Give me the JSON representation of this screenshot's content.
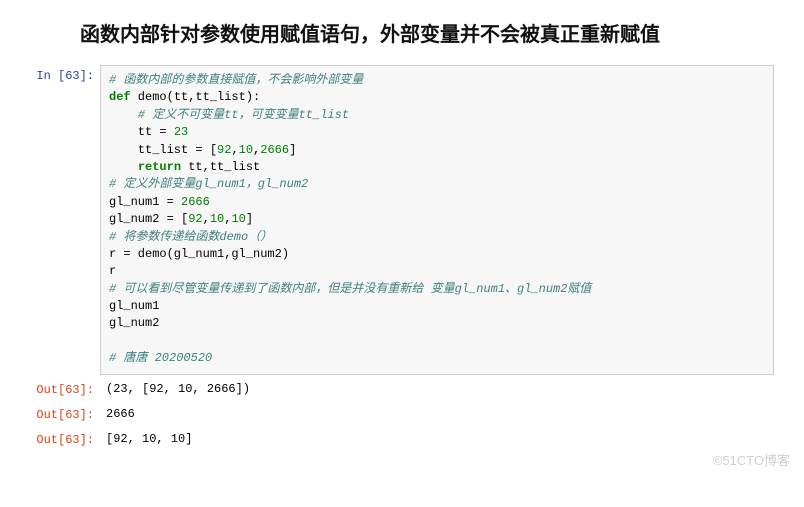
{
  "title": "函数内部针对参数使用赋值语句，外部变量并不会被真正重新赋值",
  "prompts": {
    "in": "In  [63]:",
    "out": "Out[63]:"
  },
  "code": {
    "l01": "# 函数内部的参数直接赋值，不会影响外部变量",
    "l02a": "def",
    "l02b": " demo(tt,tt_list):",
    "l03": "    # 定义不可变量tt，可变变量tt_list",
    "l04a": "    tt = ",
    "l04b": "23",
    "l05a": "    tt_list = [",
    "l05b": "92",
    "l05c": ",",
    "l05d": "10",
    "l05e": ",",
    "l05f": "2666",
    "l05g": "]",
    "l06a": "    ",
    "l06b": "return",
    "l06c": " tt,tt_list",
    "l07": "# 定义外部变量gl_num1，gl_num2",
    "l08a": "gl_num1 = ",
    "l08b": "2666",
    "l09a": "gl_num2 = [",
    "l09b": "92",
    "l09c": ",",
    "l09d": "10",
    "l09e": ",",
    "l09f": "10",
    "l09g": "]",
    "l10": "# 将参数传递给函数demo（）",
    "l11": "r = demo(gl_num1,gl_num2)",
    "l12": "r",
    "l13": "# 可以看到尽管变量传递到了函数内部，但是并没有重新给 变量gl_num1、gl_num2赋值",
    "l14": "gl_num1",
    "l15": "gl_num2",
    "l16": "",
    "l17": "# 唐唐 20200520"
  },
  "outputs": {
    "o1": "(23, [92, 10, 2666])",
    "o2": "2666",
    "o3": "[92, 10, 10]"
  },
  "watermark": "©51CTO博客"
}
